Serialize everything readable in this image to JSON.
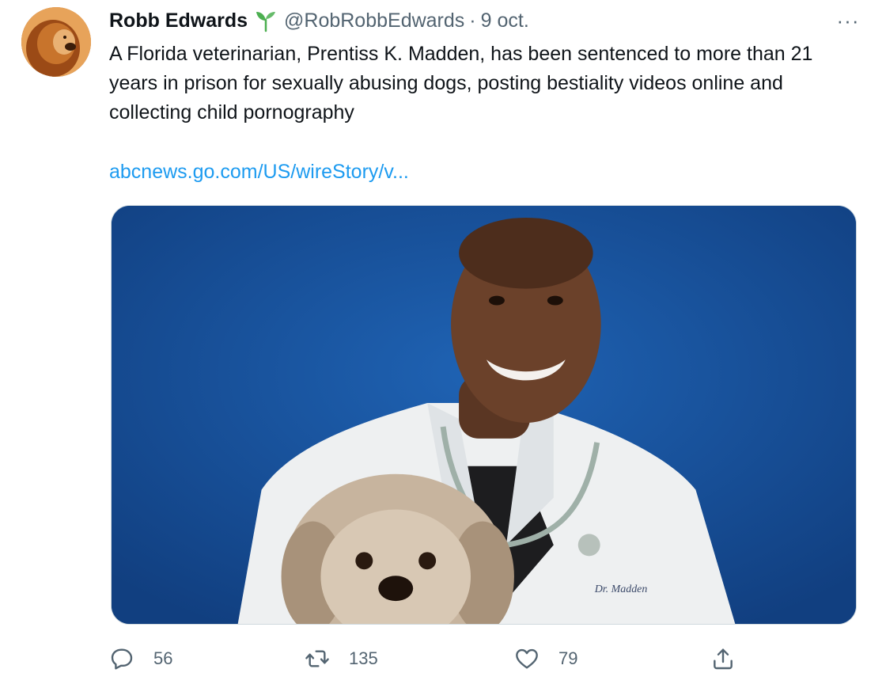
{
  "author": {
    "name": "Robb Edwards",
    "handle": "@RobRobbEdwards",
    "separator": "·",
    "date": "9 oct.",
    "avatar_icon": "lion-avatar",
    "badge_icon": "sprout-icon"
  },
  "menu": {
    "more_label": "···"
  },
  "tweet": {
    "text": "A Florida veterinarian, Prentiss K. Madden, has been sentenced to more than 21 years in prison for sexually abusing dogs, posting bestiality videos online and collecting child pornography",
    "link": "abcnews.go.com/US/wireStory/v..."
  },
  "media": {
    "type": "photo",
    "coat_text": "Dr. Madden"
  },
  "actions": {
    "reply_count": "56",
    "retweet_count": "135",
    "like_count": "79"
  },
  "colors": {
    "link": "#1d9bf0",
    "secondary_text": "#536471",
    "badge": "#4caf50",
    "photo_background": "#1a56a0"
  }
}
